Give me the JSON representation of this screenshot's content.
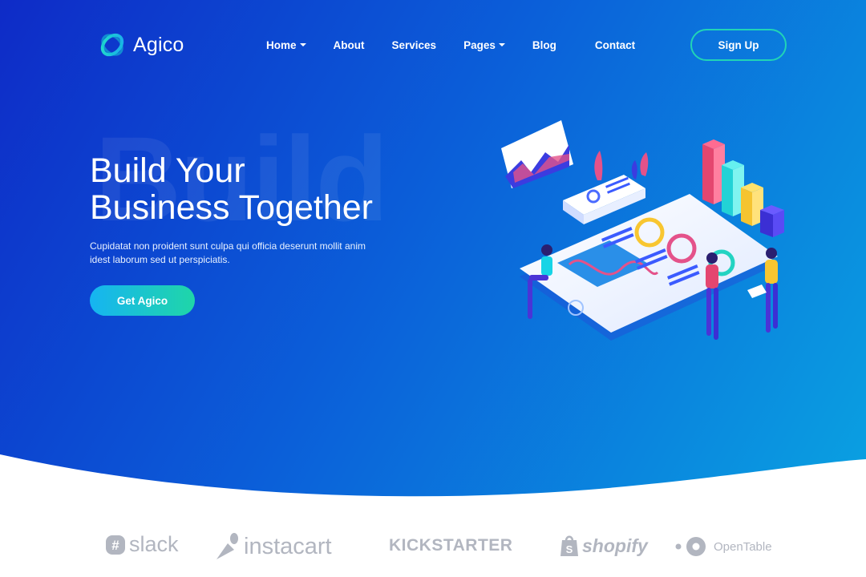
{
  "brand": {
    "name": "Agico"
  },
  "nav": {
    "items": [
      {
        "label": "Home",
        "dropdown": true
      },
      {
        "label": "About",
        "dropdown": false
      },
      {
        "label": "Services",
        "dropdown": false
      },
      {
        "label": "Pages",
        "dropdown": true
      },
      {
        "label": "Blog",
        "dropdown": false
      },
      {
        "label": "Contact",
        "dropdown": false
      }
    ],
    "signup_label": "Sign Up"
  },
  "hero": {
    "watermark": "Build",
    "headline_line1": "Build Your",
    "headline_line2": "Business Together",
    "subtext": "Cupidatat non proident sunt culpa qui officia deserunt mollit anim idest laborum sed ut perspiciatis.",
    "cta_label": "Get Agico"
  },
  "partners": [
    {
      "name": "slack",
      "icon": "slack-icon"
    },
    {
      "name": "instacart",
      "icon": "carrot-icon"
    },
    {
      "name": "KICKSTARTER",
      "icon": ""
    },
    {
      "name": "shopify",
      "icon": "shopping-bag-icon"
    },
    {
      "name": "OpenTable",
      "icon": "opentable-dots-icon"
    }
  ],
  "colors": {
    "gradient_start": "#0e2bc7",
    "gradient_end": "#0aa6e2",
    "accent_teal": "#21d4b6",
    "cta_start": "#16b4f2",
    "cta_end": "#1fd6a8",
    "partner_gray": "#b2b6c0"
  }
}
